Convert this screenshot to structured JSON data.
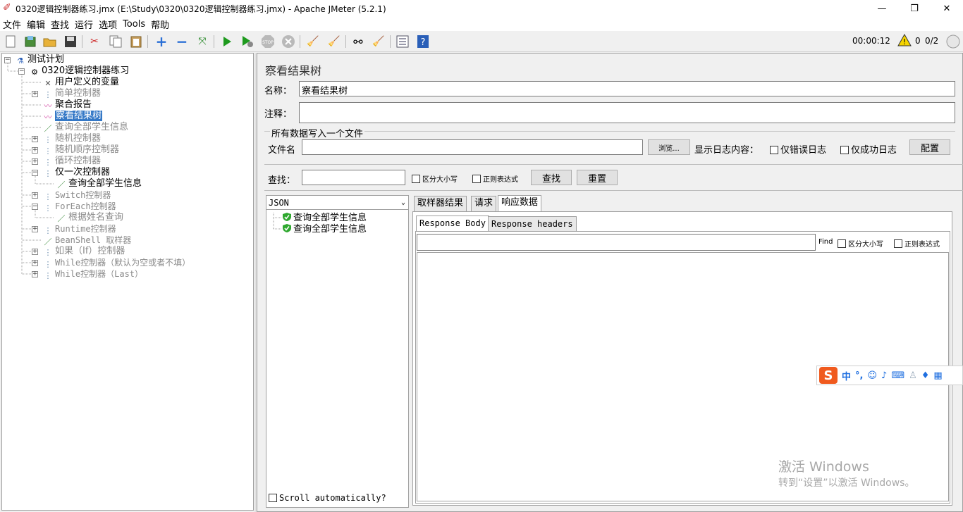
{
  "window": {
    "title": "0320逻辑控制器练习.jmx (E:\\Study\\0320\\0320逻辑控制器练习.jmx) - Apache JMeter (5.2.1)",
    "minimize": "—",
    "maximize": "❐",
    "close": "✕"
  },
  "menu": [
    "文件",
    "编辑",
    "查找",
    "运行",
    "选项",
    "Tools",
    "帮助"
  ],
  "toolbar_status": {
    "timer": "00:00:12",
    "warnings": "0",
    "threads": "0/2"
  },
  "tree": {
    "root": "测试计划",
    "plan": "0320逻辑控制器练习",
    "items": [
      {
        "label": "用户定义的变量",
        "icon": "wrench-icon"
      },
      {
        "label": "简单控制器",
        "icon": "controller-icon"
      },
      {
        "label": "聚合报告",
        "icon": "report-icon"
      },
      {
        "label": "察看结果树",
        "icon": "report-icon"
      },
      {
        "label": "查询全部学生信息",
        "icon": "sampler-icon"
      },
      {
        "label": "随机控制器",
        "icon": "controller-icon"
      },
      {
        "label": "随机顺序控制器",
        "icon": "controller-icon"
      },
      {
        "label": "循环控制器",
        "icon": "controller-icon"
      },
      {
        "label": "仅一次控制器",
        "icon": "controller-icon"
      },
      {
        "label": "查询全部学生信息",
        "icon": "sampler-icon"
      },
      {
        "label": "Switch控制器",
        "icon": "controller-icon"
      },
      {
        "label": "ForEach控制器",
        "icon": "controller-icon"
      },
      {
        "label": "根据姓名查询",
        "icon": "sampler-icon"
      },
      {
        "label": "Runtime控制器",
        "icon": "controller-icon"
      },
      {
        "label": "BeanShell 取样器",
        "icon": "sampler-icon"
      },
      {
        "label": "如果（If）控制器",
        "icon": "controller-icon"
      },
      {
        "label": "While控制器（默认为空或者不填）",
        "icon": "controller-icon"
      },
      {
        "label": "While控制器（Last）",
        "icon": "controller-icon"
      }
    ]
  },
  "panel": {
    "title": "察看结果树",
    "name_label": "名称：",
    "name_value": "察看结果树",
    "comment_label": "注释：",
    "comment_value": "",
    "file_section": "所有数据写入一个文件",
    "filename_label": "文件名",
    "filename_value": "",
    "browse": "浏览...",
    "log_label": "显示日志内容：",
    "errors_only": "仅错误日志",
    "success_only": "仅成功日志",
    "configure": "配置",
    "search_label": "查找：",
    "search_value": "",
    "case_sensitive": "区分大小写",
    "regex": "正则表达式",
    "find_btn": "查找",
    "reset_btn": "重置",
    "renderer": "JSON",
    "results": [
      "查询全部学生信息",
      "查询全部学生信息"
    ],
    "scroll_auto": "Scroll automatically?",
    "tabs": [
      "取样器结果",
      "请求",
      "响应数据"
    ],
    "subtabs": [
      "Response Body",
      "Response headers"
    ],
    "find_label": "Find",
    "find_case": "区分大小写",
    "find_regex": "正则表达式"
  },
  "ime": {
    "logo": "S",
    "mode": "中",
    "punct": "°,"
  },
  "watermark": {
    "line1": "激活 Windows",
    "line2": "转到“设置”以激活 Windows。"
  }
}
